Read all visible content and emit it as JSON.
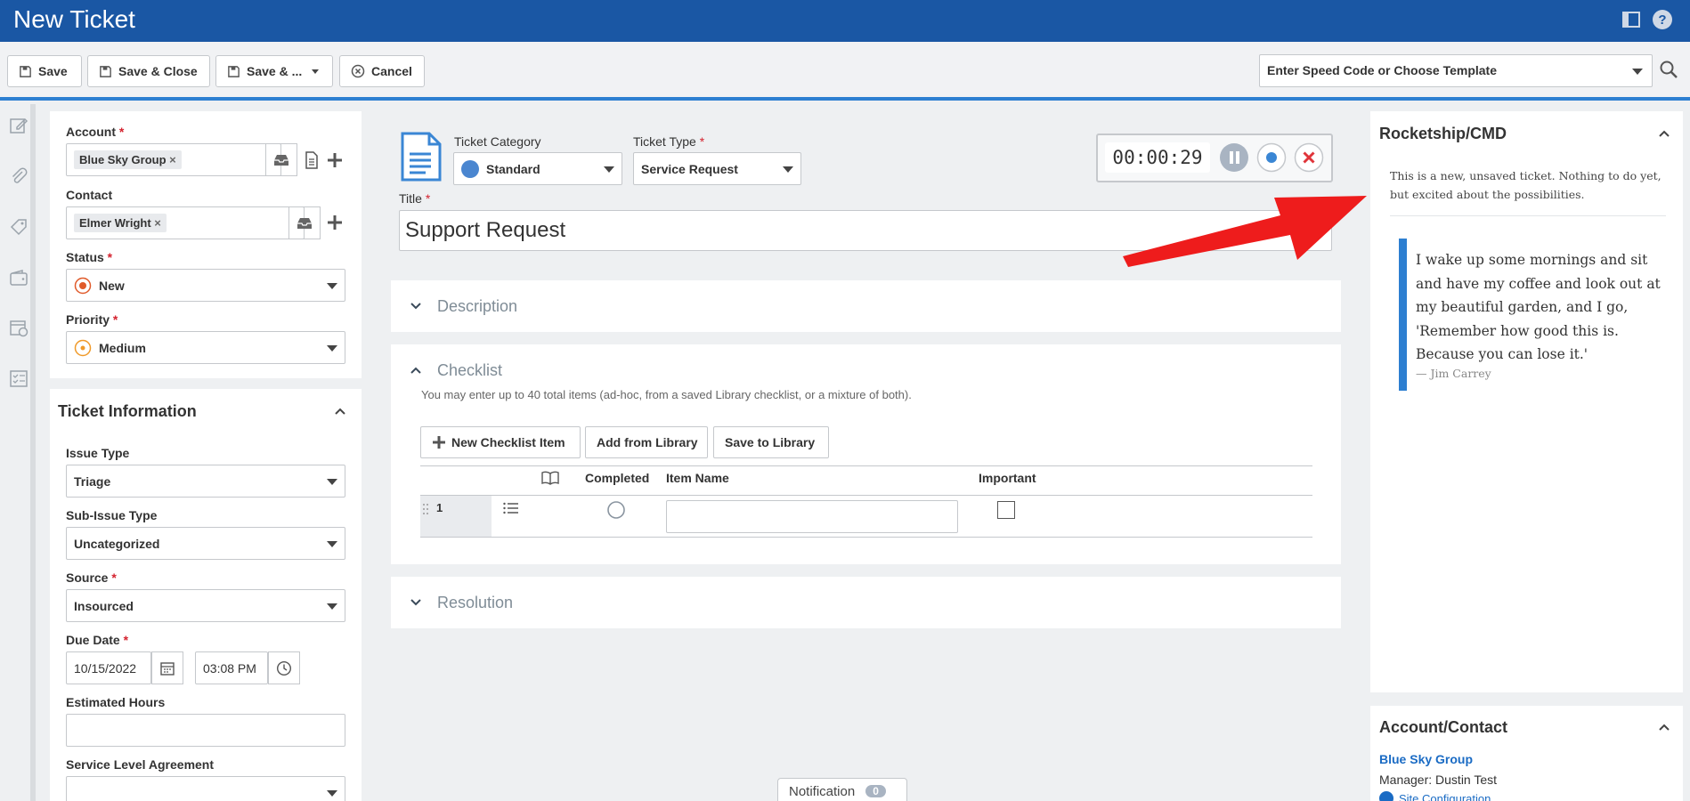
{
  "title": "New Ticket",
  "toolbar": {
    "save": "Save",
    "save_close": "Save & Close",
    "save_more": "Save & ...",
    "cancel": "Cancel",
    "speed_placeholder": "Enter Speed Code or Choose Template"
  },
  "left": {
    "account_label": "Account",
    "account_value": "Blue Sky Group",
    "contact_label": "Contact",
    "contact_value": "Elmer Wright",
    "status_label": "Status",
    "status_value": "New",
    "priority_label": "Priority",
    "priority_value": "Medium",
    "ticket_info_title": "Ticket Information",
    "issue_type_label": "Issue Type",
    "issue_type_value": "Triage",
    "sub_issue_label": "Sub-Issue Type",
    "sub_issue_value": "Uncategorized",
    "source_label": "Source",
    "source_value": "Insourced",
    "due_date_label": "Due Date",
    "due_date_value": "10/15/2022",
    "due_time_value": "03:08 PM",
    "est_hours_label": "Estimated Hours",
    "sla_label": "Service Level Agreement"
  },
  "main": {
    "category_label": "Ticket Category",
    "category_value": "Standard",
    "type_label": "Ticket Type",
    "type_value": "Service Request",
    "timer": "00:00:29",
    "title_label": "Title",
    "title_value": "Support Request",
    "description": "Description",
    "checklist": "Checklist",
    "checklist_hint": "You may enter up to 40 total items (ad-hoc, from a saved Library checklist, or a mixture of both).",
    "new_item": "New Checklist Item",
    "add_library": "Add from Library",
    "save_library": "Save to Library",
    "col_completed": "Completed",
    "col_item": "Item Name",
    "col_important": "Important",
    "row_number": "1",
    "resolution": "Resolution",
    "notification_label": "Notification",
    "notification_count": "0"
  },
  "right": {
    "rocketship_title": "Rocketship/CMD",
    "rocketship_msg": "This is a new, unsaved ticket. Nothing to do yet, but excited about the possibilities.",
    "quote_lines": [
      "I wake up some mornings and sit",
      "and have my coffee and look out at",
      "my beautiful garden, and I go,",
      "'Remember how good this is.",
      "Because you can lose it.'"
    ],
    "quote_author": "— Jim Carrey",
    "account_contact_title": "Account/Contact",
    "account_link": "Blue Sky Group",
    "manager": "Manager: Dustin Test",
    "site_config": "Site Configuration"
  },
  "colors": {
    "header_blue": "#1a57a4",
    "accent_blue": "#2d7fd1",
    "required_red": "#d4232f",
    "arrow_red": "#ee1c1c",
    "link_blue": "#1a6bc4"
  }
}
